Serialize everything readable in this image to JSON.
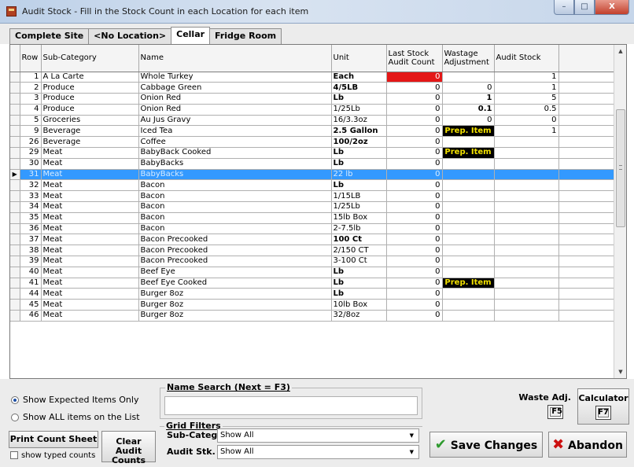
{
  "window": {
    "title": "Audit Stock - Fill in the Stock Count in each Location for each item",
    "minimize": "–",
    "maximize": "□",
    "close": "X"
  },
  "tabs": [
    {
      "label": "Complete Site",
      "active": false
    },
    {
      "label": "<No Location>",
      "active": false
    },
    {
      "label": "Cellar",
      "active": true
    },
    {
      "label": "Fridge Room",
      "active": false
    }
  ],
  "grid": {
    "headers": {
      "row": "Row",
      "subcategory": "Sub-Category",
      "name": "Name",
      "unit": "Unit",
      "last_stock": "Last Stock Audit Count",
      "wastage": "Wastage Adjustment",
      "audit": "Audit Stock"
    },
    "selected_row_indicator": "▶",
    "prep_item_label": "Prep. Item",
    "rows": [
      {
        "row": "1",
        "subcategory": "A La Carte",
        "name": "Whole Turkey",
        "unit": "Each",
        "unit_bold": true,
        "last": "0",
        "last_red": true,
        "wastage": "",
        "audit": "1"
      },
      {
        "row": "2",
        "subcategory": "Produce",
        "name": "Cabbage Green",
        "unit": "4/5LB",
        "unit_bold": true,
        "last": "0",
        "wastage": "0",
        "audit": "1"
      },
      {
        "row": "3",
        "subcategory": "Produce",
        "name": "Onion Red",
        "unit": "Lb",
        "unit_bold": true,
        "last": "0",
        "wastage": "1",
        "wastage_bold": true,
        "audit": "5"
      },
      {
        "row": "4",
        "subcategory": "Produce",
        "name": "Onion Red",
        "unit": "1/25Lb",
        "last": "0",
        "wastage": "0.1",
        "wastage_bold": true,
        "audit": "0.5"
      },
      {
        "row": "5",
        "subcategory": "Groceries",
        "name": "Au Jus Gravy",
        "unit": "16/3.3oz",
        "last": "0",
        "wastage": "0",
        "audit": "0"
      },
      {
        "row": "9",
        "subcategory": "Beverage",
        "name": "Iced Tea",
        "unit": "2.5 Gallon",
        "unit_bold": true,
        "last": "0",
        "wastage_prep": true,
        "audit": "1"
      },
      {
        "row": "26",
        "subcategory": "Beverage",
        "name": "Coffee",
        "unit": "100/2oz",
        "unit_bold": true,
        "last": "0",
        "wastage": "",
        "audit": ""
      },
      {
        "row": "29",
        "subcategory": "Meat",
        "name": "BabyBack Cooked",
        "unit": "Lb",
        "unit_bold": true,
        "last": "0",
        "wastage_prep": true,
        "audit": ""
      },
      {
        "row": "30",
        "subcategory": "Meat",
        "name": "BabyBacks",
        "unit": "Lb",
        "unit_bold": true,
        "last": "0",
        "wastage": "",
        "audit": ""
      },
      {
        "row": "31",
        "subcategory": "Meat",
        "name": "BabyBacks",
        "unit": "22 lb",
        "last": "0",
        "wastage": "",
        "audit": "",
        "selected": true
      },
      {
        "row": "32",
        "subcategory": "Meat",
        "name": "Bacon",
        "unit": "Lb",
        "unit_bold": true,
        "last": "0",
        "wastage": "",
        "audit": ""
      },
      {
        "row": "33",
        "subcategory": "Meat",
        "name": "Bacon",
        "unit": "1/15LB",
        "last": "0",
        "wastage": "",
        "audit": ""
      },
      {
        "row": "34",
        "subcategory": "Meat",
        "name": "Bacon",
        "unit": "1/25Lb",
        "last": "0",
        "wastage": "",
        "audit": ""
      },
      {
        "row": "35",
        "subcategory": "Meat",
        "name": "Bacon",
        "unit": "15lb Box",
        "last": "0",
        "wastage": "",
        "audit": ""
      },
      {
        "row": "36",
        "subcategory": "Meat",
        "name": "Bacon",
        "unit": "2-7.5lb",
        "last": "0",
        "wastage": "",
        "audit": ""
      },
      {
        "row": "37",
        "subcategory": "Meat",
        "name": "Bacon Precooked",
        "unit": "100 Ct",
        "unit_bold": true,
        "last": "0",
        "wastage": "",
        "audit": ""
      },
      {
        "row": "38",
        "subcategory": "Meat",
        "name": "Bacon Precooked",
        "unit": "2/150 CT",
        "last": "0",
        "wastage": "",
        "audit": ""
      },
      {
        "row": "39",
        "subcategory": "Meat",
        "name": "Bacon Precooked",
        "unit": "3-100 Ct",
        "last": "0",
        "wastage": "",
        "audit": ""
      },
      {
        "row": "40",
        "subcategory": "Meat",
        "name": "Beef Eye",
        "unit": "Lb",
        "unit_bold": true,
        "last": "0",
        "wastage": "",
        "audit": ""
      },
      {
        "row": "41",
        "subcategory": "Meat",
        "name": "Beef Eye Cooked",
        "unit": "Lb",
        "unit_bold": true,
        "last": "0",
        "wastage_prep": true,
        "audit": ""
      },
      {
        "row": "44",
        "subcategory": "Meat",
        "name": "Burger 8oz",
        "unit": "Lb",
        "unit_bold": true,
        "last": "0",
        "wastage": "",
        "audit": ""
      },
      {
        "row": "45",
        "subcategory": "Meat",
        "name": "Burger 8oz",
        "unit": "10lb Box",
        "last": "0",
        "wastage": "",
        "audit": ""
      },
      {
        "row": "46",
        "subcategory": "Meat",
        "name": "Burger 8oz",
        "unit": "32/8oz",
        "last": "0",
        "wastage": "",
        "audit": ""
      }
    ]
  },
  "options": {
    "show_expected": "Show Expected Items Only",
    "show_all": "Show ALL items on the List",
    "selected": "show_expected"
  },
  "name_search": {
    "legend": "Name Search (Next = F3)",
    "value": ""
  },
  "grid_filters": {
    "legend": "Grid Filters",
    "subcateg_label": "Sub-Categ.",
    "subcateg_value": "Show All",
    "audit_label": "Audit Stk.",
    "audit_value": "Show All"
  },
  "buttons": {
    "print_count_sheet": "Print Count Sheet",
    "show_typed_counts": "show typed counts",
    "clear_audit_line1": "Clear Audit",
    "clear_audit_line2": "Counts",
    "waste_adj": "Waste Adj.",
    "waste_key": "F5",
    "calculator": "Calculator",
    "calculator_key": "F7",
    "save_changes": "Save Changes",
    "abandon": "Abandon"
  },
  "colors": {
    "selected_row": "#3399ff",
    "zero_highlight": "#e41717",
    "prep_item_bg": "#000000",
    "prep_item_text": "#f2e100"
  }
}
